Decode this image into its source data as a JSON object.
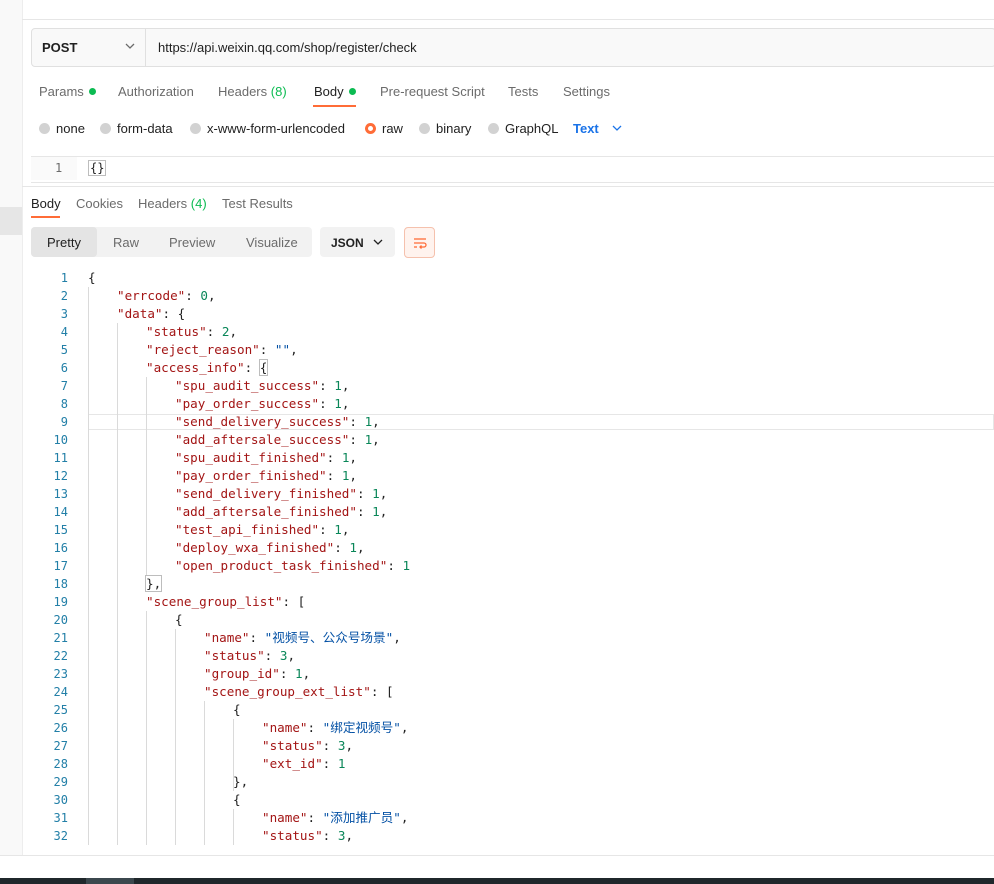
{
  "request": {
    "method": "POST",
    "url": "https://api.weixin.qq.com/shop/register/check"
  },
  "request_tabs": [
    {
      "label": "Params",
      "indicator": "dot"
    },
    {
      "label": "Authorization"
    },
    {
      "label": "Headers",
      "count": "(8)"
    },
    {
      "label": "Body",
      "indicator": "dot",
      "active": true
    },
    {
      "label": "Pre-request Script"
    },
    {
      "label": "Tests"
    },
    {
      "label": "Settings"
    }
  ],
  "body_options": [
    {
      "label": "none"
    },
    {
      "label": "form-data"
    },
    {
      "label": "x-www-form-urlencoded"
    },
    {
      "label": "raw",
      "selected": true
    },
    {
      "label": "binary"
    },
    {
      "label": "GraphQL"
    }
  ],
  "body_format": "Text",
  "request_editor": {
    "line": "1",
    "code": "{}"
  },
  "response_tabs": [
    {
      "label": "Body",
      "active": true
    },
    {
      "label": "Cookies"
    },
    {
      "label": "Headers",
      "count": "(4)"
    },
    {
      "label": "Test Results"
    }
  ],
  "view_modes": [
    "Pretty",
    "Raw",
    "Preview",
    "Visualize"
  ],
  "response_format": "JSON",
  "icons": {
    "method_dropdown": "chevron-down-icon",
    "format_dropdown": "chevron-down-icon",
    "wrap": "wrap-lines-icon"
  },
  "colors": {
    "accent": "#ff6c37",
    "success": "#0cbb52",
    "link": "#1a73e8"
  },
  "response_lines": [
    {
      "n": "1",
      "indent": 0,
      "text": "{"
    },
    {
      "n": "2",
      "indent": 1,
      "key": "\"errcode\"",
      "sep": ": ",
      "val": "0",
      "vt": "n",
      "tail": ","
    },
    {
      "n": "3",
      "indent": 1,
      "key": "\"data\"",
      "sep": ": ",
      "tail": "{"
    },
    {
      "n": "4",
      "indent": 2,
      "key": "\"status\"",
      "sep": ": ",
      "val": "2",
      "vt": "n",
      "tail": ","
    },
    {
      "n": "5",
      "indent": 2,
      "key": "\"reject_reason\"",
      "sep": ": ",
      "val": "\"\"",
      "vt": "s",
      "tail": ","
    },
    {
      "n": "6",
      "indent": 2,
      "key": "\"access_info\"",
      "sep": ": ",
      "tail": "{"
    },
    {
      "n": "7",
      "indent": 3,
      "key": "\"spu_audit_success\"",
      "sep": ": ",
      "val": "1",
      "vt": "n",
      "tail": ","
    },
    {
      "n": "8",
      "indent": 3,
      "key": "\"pay_order_success\"",
      "sep": ": ",
      "val": "1",
      "vt": "n",
      "tail": ","
    },
    {
      "n": "9",
      "indent": 3,
      "key": "\"send_delivery_success\"",
      "sep": ": ",
      "val": "1",
      "vt": "n",
      "tail": ","
    },
    {
      "n": "10",
      "indent": 3,
      "key": "\"add_aftersale_success\"",
      "sep": ": ",
      "val": "1",
      "vt": "n",
      "tail": ","
    },
    {
      "n": "11",
      "indent": 3,
      "key": "\"spu_audit_finished\"",
      "sep": ": ",
      "val": "1",
      "vt": "n",
      "tail": ","
    },
    {
      "n": "12",
      "indent": 3,
      "key": "\"pay_order_finished\"",
      "sep": ": ",
      "val": "1",
      "vt": "n",
      "tail": ","
    },
    {
      "n": "13",
      "indent": 3,
      "key": "\"send_delivery_finished\"",
      "sep": ": ",
      "val": "1",
      "vt": "n",
      "tail": ","
    },
    {
      "n": "14",
      "indent": 3,
      "key": "\"add_aftersale_finished\"",
      "sep": ": ",
      "val": "1",
      "vt": "n",
      "tail": ","
    },
    {
      "n": "15",
      "indent": 3,
      "key": "\"test_api_finished\"",
      "sep": ": ",
      "val": "1",
      "vt": "n",
      "tail": ","
    },
    {
      "n": "16",
      "indent": 3,
      "key": "\"deploy_wxa_finished\"",
      "sep": ": ",
      "val": "1",
      "vt": "n",
      "tail": ","
    },
    {
      "n": "17",
      "indent": 3,
      "key": "\"open_product_task_finished\"",
      "sep": ": ",
      "val": "1",
      "vt": "n",
      "tail": ""
    },
    {
      "n": "18",
      "indent": 2,
      "text": "},"
    },
    {
      "n": "19",
      "indent": 2,
      "key": "\"scene_group_list\"",
      "sep": ": ",
      "tail": "["
    },
    {
      "n": "20",
      "indent": 3,
      "text": "{"
    },
    {
      "n": "21",
      "indent": 4,
      "key": "\"name\"",
      "sep": ": ",
      "val": "\"视频号、公众号场景\"",
      "vt": "s",
      "tail": ","
    },
    {
      "n": "22",
      "indent": 4,
      "key": "\"status\"",
      "sep": ": ",
      "val": "3",
      "vt": "n",
      "tail": ","
    },
    {
      "n": "23",
      "indent": 4,
      "key": "\"group_id\"",
      "sep": ": ",
      "val": "1",
      "vt": "n",
      "tail": ","
    },
    {
      "n": "24",
      "indent": 4,
      "key": "\"scene_group_ext_list\"",
      "sep": ": ",
      "tail": "["
    },
    {
      "n": "25",
      "indent": 5,
      "text": "{"
    },
    {
      "n": "26",
      "indent": 6,
      "key": "\"name\"",
      "sep": ": ",
      "val": "\"绑定视频号\"",
      "vt": "s",
      "tail": ","
    },
    {
      "n": "27",
      "indent": 6,
      "key": "\"status\"",
      "sep": ": ",
      "val": "3",
      "vt": "n",
      "tail": ","
    },
    {
      "n": "28",
      "indent": 6,
      "key": "\"ext_id\"",
      "sep": ": ",
      "val": "1",
      "vt": "n",
      "tail": ""
    },
    {
      "n": "29",
      "indent": 5,
      "text": "},"
    },
    {
      "n": "30",
      "indent": 5,
      "text": "{"
    },
    {
      "n": "31",
      "indent": 6,
      "key": "\"name\"",
      "sep": ": ",
      "val": "\"添加推广员\"",
      "vt": "s",
      "tail": ","
    },
    {
      "n": "32",
      "indent": 6,
      "key": "\"status\"",
      "sep": ": ",
      "val": "3",
      "vt": "n",
      "tail": ","
    }
  ]
}
